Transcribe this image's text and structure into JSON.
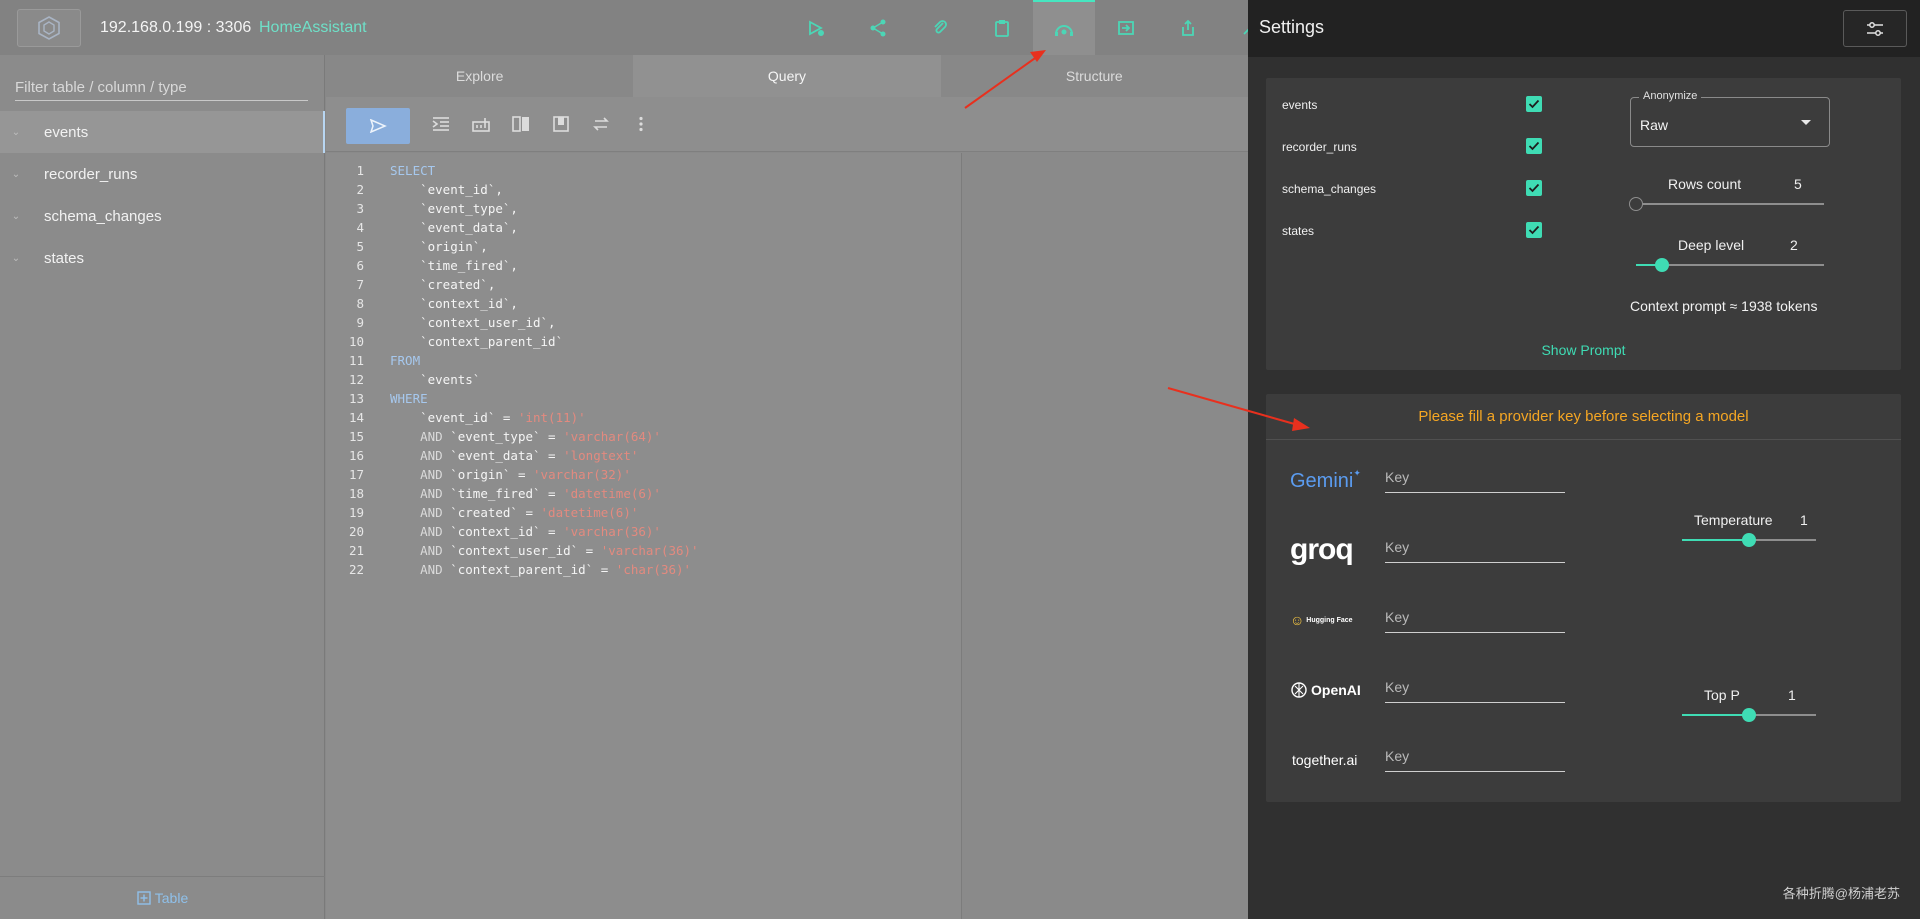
{
  "header": {
    "connection": "192.168.0.199 : 3306",
    "database": "HomeAssistant"
  },
  "sidebar": {
    "filter_placeholder": "Filter table / column / type",
    "tables": [
      "events",
      "recorder_runs",
      "schema_changes",
      "states"
    ],
    "footer_label": "Table"
  },
  "main": {
    "tabs": [
      {
        "label": "Explore"
      },
      {
        "label": "Query"
      },
      {
        "label": "Structure"
      }
    ],
    "active_tab": "Query"
  },
  "editor": {
    "lines": [
      {
        "n": "1",
        "parts": [
          {
            "t": "SELECT",
            "c": "kw"
          }
        ]
      },
      {
        "n": "2",
        "parts": [
          {
            "t": "    `event_id`,",
            "c": ""
          }
        ]
      },
      {
        "n": "3",
        "parts": [
          {
            "t": "    `event_type`,",
            "c": ""
          }
        ]
      },
      {
        "n": "4",
        "parts": [
          {
            "t": "    `event_data`,",
            "c": ""
          }
        ]
      },
      {
        "n": "5",
        "parts": [
          {
            "t": "    `origin`,",
            "c": ""
          }
        ]
      },
      {
        "n": "6",
        "parts": [
          {
            "t": "    `time_fired`,",
            "c": ""
          }
        ]
      },
      {
        "n": "7",
        "parts": [
          {
            "t": "    `created`,",
            "c": ""
          }
        ]
      },
      {
        "n": "8",
        "parts": [
          {
            "t": "    `context_id`,",
            "c": ""
          }
        ]
      },
      {
        "n": "9",
        "parts": [
          {
            "t": "    `context_user_id`,",
            "c": ""
          }
        ]
      },
      {
        "n": "10",
        "parts": [
          {
            "t": "    `context_parent_id`",
            "c": ""
          }
        ]
      },
      {
        "n": "11",
        "parts": [
          {
            "t": "FROM",
            "c": "kw"
          }
        ]
      },
      {
        "n": "12",
        "parts": [
          {
            "t": "    `events`",
            "c": ""
          }
        ]
      },
      {
        "n": "13",
        "parts": [
          {
            "t": "WHERE",
            "c": "kw"
          }
        ]
      },
      {
        "n": "14",
        "parts": [
          {
            "t": "    `event_id` = ",
            "c": ""
          },
          {
            "t": "'int(11)'",
            "c": "str"
          }
        ]
      },
      {
        "n": "15",
        "parts": [
          {
            "t": "    AND ",
            "c": "op"
          },
          {
            "t": "`event_type` = ",
            "c": ""
          },
          {
            "t": "'varchar(64)'",
            "c": "str"
          }
        ]
      },
      {
        "n": "16",
        "parts": [
          {
            "t": "    AND ",
            "c": "op"
          },
          {
            "t": "`event_data` = ",
            "c": ""
          },
          {
            "t": "'longtext'",
            "c": "str"
          }
        ]
      },
      {
        "n": "17",
        "parts": [
          {
            "t": "    AND ",
            "c": "op"
          },
          {
            "t": "`origin` = ",
            "c": ""
          },
          {
            "t": "'varchar(32)'",
            "c": "str"
          }
        ]
      },
      {
        "n": "18",
        "parts": [
          {
            "t": "    AND ",
            "c": "op"
          },
          {
            "t": "`time_fired` = ",
            "c": ""
          },
          {
            "t": "'datetime(6)'",
            "c": "str"
          }
        ]
      },
      {
        "n": "19",
        "parts": [
          {
            "t": "    AND ",
            "c": "op"
          },
          {
            "t": "`created` = ",
            "c": ""
          },
          {
            "t": "'datetime(6)'",
            "c": "str"
          }
        ]
      },
      {
        "n": "20",
        "parts": [
          {
            "t": "    AND ",
            "c": "op"
          },
          {
            "t": "`context_id` = ",
            "c": ""
          },
          {
            "t": "'varchar(36)'",
            "c": "str"
          }
        ]
      },
      {
        "n": "21",
        "parts": [
          {
            "t": "    AND ",
            "c": "op"
          },
          {
            "t": "`context_user_id` = ",
            "c": ""
          },
          {
            "t": "'varchar(36)'",
            "c": "str"
          }
        ]
      },
      {
        "n": "22",
        "parts": [
          {
            "t": "    AND ",
            "c": "op"
          },
          {
            "t": "`context_parent_id` = ",
            "c": ""
          },
          {
            "t": "'char(36)'",
            "c": "str"
          }
        ]
      }
    ]
  },
  "settings": {
    "title": "Settings",
    "tables": [
      {
        "name": "events",
        "checked": true
      },
      {
        "name": "recorder_runs",
        "checked": true
      },
      {
        "name": "schema_changes",
        "checked": true
      },
      {
        "name": "states",
        "checked": true
      }
    ],
    "anonymize": {
      "label": "Anonymize",
      "value": "Raw"
    },
    "rows_count": {
      "label": "Rows count",
      "value": "5",
      "fraction": 0.0
    },
    "deep_level": {
      "label": "Deep level",
      "value": "2",
      "fraction": 0.14
    },
    "context_prompt": "Context prompt ≈ 1938 tokens",
    "show_prompt": "Show Prompt",
    "provider_warning": "Please fill a provider key before selecting a model",
    "providers": [
      {
        "name": "Gemini",
        "placeholder": "Key"
      },
      {
        "name": "groq",
        "placeholder": "Key"
      },
      {
        "name": "Hugging Face",
        "placeholder": "Key"
      },
      {
        "name": "OpenAI",
        "placeholder": "Key"
      },
      {
        "name": "together.ai",
        "placeholder": "Key"
      }
    ],
    "temperature": {
      "label": "Temperature",
      "value": "1",
      "fraction": 0.5
    },
    "top_p": {
      "label": "Top P",
      "value": "1",
      "fraction": 0.5
    }
  },
  "watermark": "各种折腾@杨浦老苏",
  "colors": {
    "accent": "#3fdcb4",
    "warning": "#f5a623",
    "annotation_arrow": "#e8301e"
  }
}
